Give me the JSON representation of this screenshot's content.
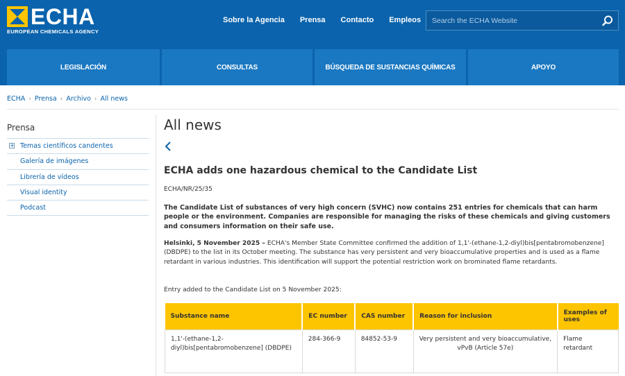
{
  "brand": {
    "name": "ECHA",
    "tagline": "EUROPEAN CHEMICALS AGENCY",
    "primary": "#0a63ac",
    "accent": "#fdc400"
  },
  "topnav": [
    "Sobre la Agencia",
    "Prensa",
    "Contacto",
    "Empleos"
  ],
  "search": {
    "placeholder": "Search the ECHA Website",
    "icon": "search-icon"
  },
  "mainnav": [
    "LEGISLACIÓN",
    "CONSULTAS",
    "BÚSQUEDA DE SUSTANCIAS QUÍMICAS",
    "APOYO"
  ],
  "breadcrumb": [
    "ECHA",
    "Prensa",
    "Archivo",
    "All news"
  ],
  "sidebar": {
    "title": "Prensa",
    "items": [
      {
        "label": "Temas científicos candentes",
        "expandable": true
      },
      {
        "label": "Galería de imágenes"
      },
      {
        "label": "Librería de vídeos"
      },
      {
        "label": "Visual identity"
      },
      {
        "label": "Podcast"
      }
    ]
  },
  "main": {
    "page_title": "All news",
    "article_title": "ECHA adds one hazardous chemical to the Candidate List",
    "ref": "ECHA/NR/25/35",
    "lead": "The Candidate List of substances of very high concern (SVHC) now contains 251 entries for chemicals that can harm people or the environment. Companies are responsible for managing the risks of these chemicals and giving customers and consumers information on their safe use.",
    "dateline": "Helsinki, 5 November 2025 –",
    "body": " ECHA's Member State Committee confirmed the addition of 1,1'-(ethane-1,2-diyl)bis[pentabromobenzene] (DBDPE) to the list in its October meeting. The substance has very persistent and very bioaccumulative properties and is used as a flame retardant in various industries. This identification will support the potential restriction work on brominated flame retardants.",
    "entry_intro": "Entry added to the Candidate List on 5 November 2025:"
  },
  "table": {
    "headers": [
      "Substance name",
      "EC number",
      "CAS number",
      "Reason for inclusion",
      "Examples of uses"
    ],
    "rows": [
      [
        "1,1'-(ethane-1,2-diyl)bis[pentabromobenzene] (DBDPE)",
        "284-366-9",
        "84852-53-9",
        "Very persistent and very bioaccumulative, vPvB (Article 57e)",
        "Flame retardant"
      ]
    ]
  }
}
